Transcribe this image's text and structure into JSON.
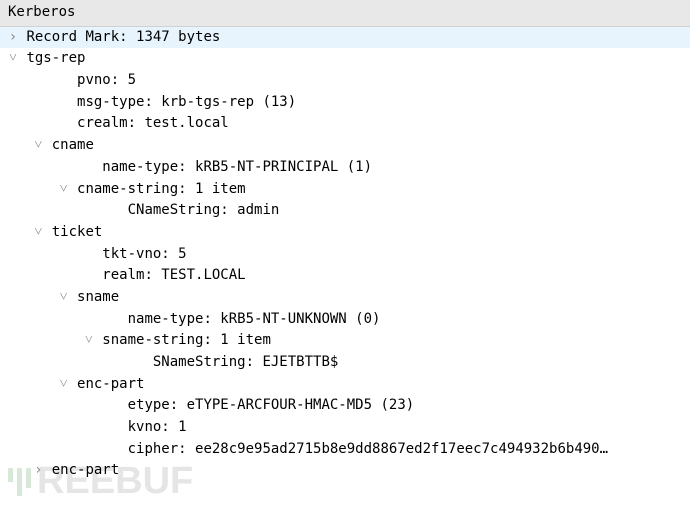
{
  "header": "Kerberos",
  "rows": [
    {
      "indent": 0,
      "arrow": "right",
      "selected": true,
      "text": "Record Mark: 1347 bytes"
    },
    {
      "indent": 0,
      "arrow": "down",
      "selected": false,
      "text": "tgs-rep"
    },
    {
      "indent": 2,
      "arrow": "",
      "selected": false,
      "text": "pvno: 5"
    },
    {
      "indent": 2,
      "arrow": "",
      "selected": false,
      "text": "msg-type: krb-tgs-rep (13)"
    },
    {
      "indent": 2,
      "arrow": "",
      "selected": false,
      "text": "crealm: test.local"
    },
    {
      "indent": 1,
      "arrow": "down",
      "selected": false,
      "text": "cname"
    },
    {
      "indent": 3,
      "arrow": "",
      "selected": false,
      "text": "name-type: kRB5-NT-PRINCIPAL (1)"
    },
    {
      "indent": 2,
      "arrow": "down",
      "selected": false,
      "text": "cname-string: 1 item"
    },
    {
      "indent": 4,
      "arrow": "",
      "selected": false,
      "text": "CNameString: admin"
    },
    {
      "indent": 1,
      "arrow": "down",
      "selected": false,
      "text": "ticket"
    },
    {
      "indent": 3,
      "arrow": "",
      "selected": false,
      "text": "tkt-vno: 5"
    },
    {
      "indent": 3,
      "arrow": "",
      "selected": false,
      "text": "realm: TEST.LOCAL"
    },
    {
      "indent": 2,
      "arrow": "down",
      "selected": false,
      "text": "sname"
    },
    {
      "indent": 4,
      "arrow": "",
      "selected": false,
      "text": "name-type: kRB5-NT-UNKNOWN (0)"
    },
    {
      "indent": 3,
      "arrow": "down",
      "selected": false,
      "text": "sname-string: 1 item"
    },
    {
      "indent": 5,
      "arrow": "",
      "selected": false,
      "text": "SNameString: EJETBTTB$"
    },
    {
      "indent": 2,
      "arrow": "down",
      "selected": false,
      "text": "enc-part"
    },
    {
      "indent": 4,
      "arrow": "",
      "selected": false,
      "text": "etype: eTYPE-ARCFOUR-HMAC-MD5 (23)"
    },
    {
      "indent": 4,
      "arrow": "",
      "selected": false,
      "text": "kvno: 1"
    },
    {
      "indent": 4,
      "arrow": "",
      "selected": false,
      "text": "cipher: ee28c9e95ad2715b8e9dd8867ed2f17eec7c494932b6b490…"
    },
    {
      "indent": 1,
      "arrow": "right",
      "selected": false,
      "text": "enc-part"
    }
  ],
  "watermark": "REEBUF"
}
